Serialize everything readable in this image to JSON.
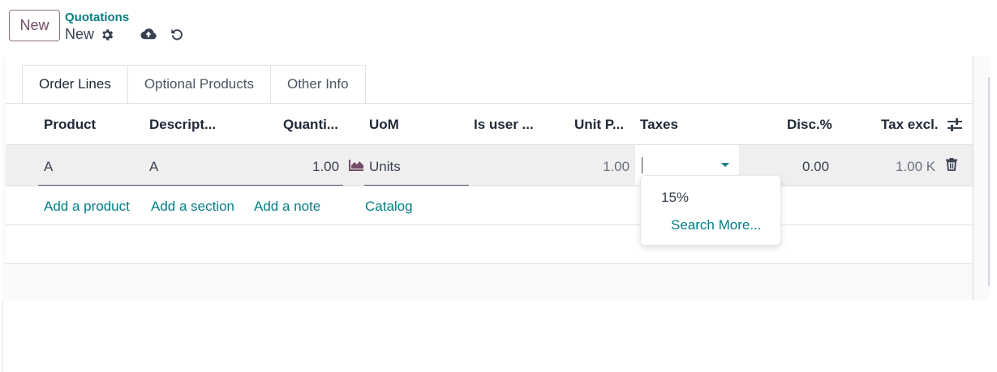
{
  "topbar": {
    "new_button": "New",
    "breadcrumb": "Quotations",
    "record_title": "New",
    "icons": [
      "gear-icon",
      "cloud-upload-icon",
      "undo-icon"
    ]
  },
  "tabs": [
    {
      "label": "Order Lines",
      "active": true
    },
    {
      "label": "Optional Products",
      "active": false
    },
    {
      "label": "Other Info",
      "active": false
    }
  ],
  "columns": {
    "product": "Product",
    "description": "Descript...",
    "quantity": "Quanti...",
    "uom": "UoM",
    "is_user": "Is user ...",
    "unit_price": "Unit P...",
    "taxes": "Taxes",
    "discount": "Disc.%",
    "tax_excl": "Tax excl."
  },
  "line": {
    "product": "A",
    "description": "A",
    "quantity": "1.00",
    "uom": "Units",
    "unit_price": "1.00",
    "taxes": "",
    "discount": "0.00",
    "tax_excl": "1.00 K"
  },
  "actions": {
    "add_product": "Add a product",
    "add_section": "Add a section",
    "add_note": "Add a note",
    "catalog": "Catalog"
  },
  "taxes_dropdown": {
    "option": "15%",
    "search_more": "Search More..."
  },
  "colors": {
    "brand": "#714b67",
    "link": "#017e84",
    "row_highlight": "#efefef"
  }
}
